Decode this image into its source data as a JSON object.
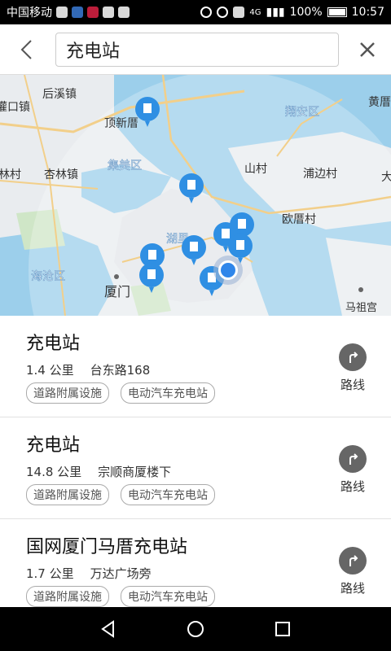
{
  "status_bar": {
    "carrier": "中国移动",
    "network": "4G",
    "battery": "100%",
    "time": "10:57"
  },
  "search": {
    "query": "充电站"
  },
  "map": {
    "labels": [
      {
        "text": "后溪镇"
      },
      {
        "text": "灌口镇"
      },
      {
        "text": "顶新厝"
      },
      {
        "text": "集美区"
      },
      {
        "text": "杏林镇"
      },
      {
        "text": "翔安区"
      },
      {
        "text": "黄厝"
      },
      {
        "text": "山村"
      },
      {
        "text": "浦边村"
      },
      {
        "text": "欧厝村"
      },
      {
        "text": "海沧区"
      },
      {
        "text": "厦门"
      },
      {
        "text": "湖里"
      },
      {
        "text": "马祖宫"
      },
      {
        "text": "林村"
      },
      {
        "text": "大"
      }
    ]
  },
  "results": [
    {
      "title": "充电站",
      "distance": "1.4 公里",
      "address": "台东路168",
      "tags": [
        "道路附属设施",
        "电动汽车充电站"
      ],
      "route_label": "路线"
    },
    {
      "title": "充电站",
      "distance": "14.8 公里",
      "address": "宗顺商厦楼下",
      "tags": [
        "道路附属设施",
        "电动汽车充电站"
      ],
      "route_label": "路线"
    },
    {
      "title": "国网厦门马厝充电站",
      "distance": "1.7 公里",
      "address": "万达广场旁",
      "tags": [
        "道路附属设施",
        "电动汽车充电站"
      ],
      "route_label": "路线"
    }
  ],
  "colors": {
    "map_water": "#9ccfeb",
    "map_land": "#e9ecef",
    "map_green": "#cfe6c7",
    "pin_blue": "#2f8fe3",
    "location_blue": "#2f86ea"
  }
}
